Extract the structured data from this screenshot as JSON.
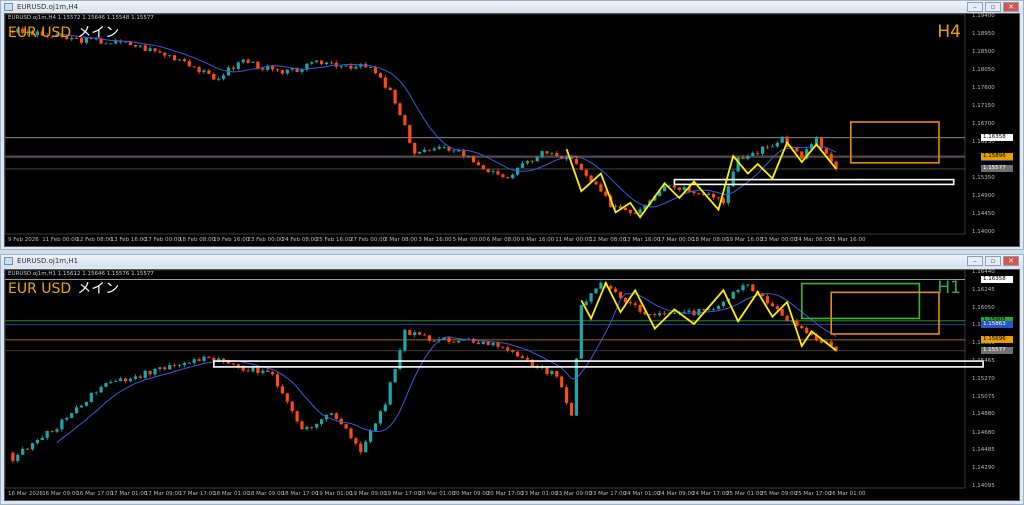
{
  "windows": [
    {
      "title": "EURUSD.oj1m,H4",
      "header": "EURUSD.oj1m,H4  1.15572 1.15646 1.15548 1.15577",
      "symbol": "EUR USD",
      "label": "メイン",
      "timeframe": "H4",
      "tf_color": "#f0a000",
      "price_labels": [
        "1.19400",
        "1.18950",
        "1.18500",
        "1.18050",
        "1.17600",
        "1.17150",
        "1.16700",
        "1.16250",
        "1.15350",
        "1.14900",
        "1.14450",
        "1.14000"
      ],
      "price_tags": [
        {
          "value": "1.16358",
          "bg": "#ffffff",
          "fg": "#000"
        },
        {
          "value": "1.15863",
          "bg": "#2a52c8",
          "fg": "#fff"
        },
        {
          "value": "1.15896",
          "bg": "#e8a000",
          "fg": "#000"
        },
        {
          "value": "1.15577",
          "bg": "#707070",
          "fg": "#fff"
        }
      ],
      "time_labels": [
        "9 Feb 2026",
        "11 Feb 00:00",
        "12 Feb 08:00",
        "13 Feb 16:00",
        "17 Feb 00:00",
        "18 Feb 08:00",
        "19 Feb 16:00",
        "23 Feb 00:00",
        "24 Feb 08:00",
        "25 Feb 16:00",
        "27 Feb 00:00",
        "2 Mar 08:00",
        "3 Mar 16:00",
        "5 Mar 00:00",
        "6 Mar 08:00",
        "9 Mar 16:00",
        "11 Mar 00:00",
        "12 Mar 08:00",
        "13 Mar 16:00",
        "17 Mar 00:00",
        "18 Mar 08:00",
        "19 Mar 16:00",
        "23 Mar 00:00",
        "24 Mar 08:00",
        "25 Mar 16:00"
      ],
      "window_buttons": [
        "minimize",
        "restore",
        "close"
      ]
    },
    {
      "title": "EURUSD.oj1m,H1",
      "header": "EURUSD.oj1m,H1  1.15612 1.15646 1.15576 1.15577",
      "symbol": "EUR USD",
      "label": "メイン",
      "timeframe": "H1",
      "tf_color": "#2eaa66",
      "price_labels": [
        "1.16440",
        "1.16245",
        "1.16050",
        "1.15855",
        "1.15660",
        "1.15465",
        "1.15270",
        "1.15075",
        "1.14880",
        "1.14680",
        "1.14485",
        "1.14290",
        "1.14095"
      ],
      "price_tags": [
        {
          "value": "1.16358",
          "bg": "#ffffff",
          "fg": "#000"
        },
        {
          "value": "1.15905",
          "bg": "#22aa33",
          "fg": "#000"
        },
        {
          "value": "1.15863",
          "bg": "#2a52c8",
          "fg": "#fff"
        },
        {
          "value": "1.15696",
          "bg": "#e8a000",
          "fg": "#000"
        },
        {
          "value": "1.15577",
          "bg": "#707070",
          "fg": "#fff"
        }
      ],
      "time_labels": [
        "16 Mar 2026",
        "16 Mar 09:00",
        "16 Mar 17:00",
        "17 Mar 01:00",
        "17 Mar 09:00",
        "17 Mar 17:00",
        "18 Mar 01:00",
        "18 Mar 09:00",
        "18 Mar 17:00",
        "19 Mar 01:00",
        "19 Mar 09:00",
        "19 Mar 17:00",
        "20 Mar 01:00",
        "20 Mar 09:00",
        "20 Mar 17:00",
        "23 Mar 01:00",
        "23 Mar 09:00",
        "23 Mar 17:00",
        "24 Mar 01:00",
        "24 Mar 09:00",
        "24 Mar 17:00",
        "25 Mar 01:00",
        "25 Mar 09:00",
        "25 Mar 17:00",
        "26 Mar 01:00"
      ],
      "window_buttons": [
        "minimize",
        "restore",
        "close"
      ]
    }
  ],
  "chart_data": [
    {
      "type": "candlestick",
      "title": "EURUSD H4",
      "ylim": [
        1.14,
        1.194
      ],
      "bull_color": "#1aa8a8",
      "bear_color": "#ff4a10",
      "ma_color": "#3a5ae0",
      "anchors": [
        [
          0,
          1.1905
        ],
        [
          11,
          1.1885
        ],
        [
          25,
          1.187
        ],
        [
          36,
          1.183
        ],
        [
          42,
          1.178
        ],
        [
          48,
          1.183
        ],
        [
          56,
          1.1795
        ],
        [
          64,
          1.1825
        ],
        [
          74,
          1.181
        ],
        [
          78,
          1.175
        ],
        [
          83,
          1.16
        ],
        [
          91,
          1.161
        ],
        [
          101,
          1.153
        ],
        [
          109,
          1.16
        ],
        [
          115,
          1.158
        ],
        [
          123,
          1.147
        ],
        [
          128,
          1.145
        ],
        [
          134,
          1.152
        ],
        [
          142,
          1.15
        ],
        [
          146,
          1.148
        ],
        [
          149,
          1.158
        ],
        [
          158,
          1.163
        ],
        [
          162,
          1.159
        ],
        [
          165,
          1.163
        ],
        [
          169,
          1.1558
        ]
      ],
      "hlines": [
        {
          "price": 1.16358,
          "color": "#9a9a9a"
        },
        {
          "price": 1.15863,
          "color": "#2a52c8"
        },
        {
          "price": 1.15896,
          "color": "#e08a00"
        },
        {
          "price": 1.15577,
          "color": "#505050"
        }
      ],
      "zigzag": [
        [
          114,
          1.1607
        ],
        [
          117,
          1.1502
        ],
        [
          121,
          1.1546
        ],
        [
          124,
          1.1449
        ],
        [
          127,
          1.1473
        ],
        [
          129,
          1.1437
        ],
        [
          134,
          1.1522
        ],
        [
          137,
          1.1485
        ],
        [
          140,
          1.1526
        ],
        [
          145,
          1.1456
        ],
        [
          148,
          1.159
        ],
        [
          151,
          1.1546
        ],
        [
          153,
          1.157
        ],
        [
          156,
          1.1534
        ],
        [
          159,
          1.1624
        ],
        [
          162,
          1.1575
        ],
        [
          165,
          1.1619
        ],
        [
          169,
          1.1558
        ]
      ],
      "projection": [
        [
          169,
          1.1539
        ],
        [
          172,
          1.1563
        ],
        [
          175,
          1.1558
        ],
        [
          178,
          1.1502
        ]
      ],
      "zones": [
        {
          "from": 136,
          "to": 193,
          "top": 1.1531,
          "bottom": 1.1519,
          "color": "#ffffff"
        },
        {
          "from": 172,
          "to": 190,
          "top": 1.1675,
          "bottom": 1.1573,
          "color": "#e88a10"
        }
      ]
    },
    {
      "type": "candlestick",
      "title": "EURUSD H1",
      "ylim": [
        1.14095,
        1.1644
      ],
      "bull_color": "#1aa8a8",
      "bear_color": "#ff4a10",
      "ma_color": "#3a5ae0",
      "anchors": [
        [
          0,
          1.1445
        ],
        [
          1,
          1.144
        ],
        [
          9,
          1.147
        ],
        [
          19,
          1.152
        ],
        [
          40,
          1.155
        ],
        [
          54,
          1.153
        ],
        [
          60,
          1.147
        ],
        [
          66,
          1.149
        ],
        [
          72,
          1.145
        ],
        [
          77,
          1.15
        ],
        [
          81,
          1.158
        ],
        [
          87,
          1.157
        ],
        [
          95,
          1.157
        ],
        [
          101,
          1.156
        ],
        [
          112,
          1.153
        ],
        [
          115,
          1.149
        ],
        [
          117,
          1.161
        ],
        [
          121,
          1.163
        ],
        [
          130,
          1.16
        ],
        [
          142,
          1.16
        ],
        [
          151,
          1.163
        ],
        [
          162,
          1.158
        ],
        [
          169,
          1.1558
        ]
      ],
      "hlines": [
        {
          "price": 1.16358,
          "color": "#cccccc"
        },
        {
          "price": 1.15905,
          "color": "#22aa33"
        },
        {
          "price": 1.15863,
          "color": "#2a52c8"
        },
        {
          "price": 1.15696,
          "color": "#e08a00"
        },
        {
          "price": 1.15577,
          "color": "#505050"
        }
      ],
      "zigzag": [
        [
          117,
          1.1613
        ],
        [
          119,
          1.1593
        ],
        [
          122,
          1.1632
        ],
        [
          125,
          1.16
        ],
        [
          128,
          1.1624
        ],
        [
          132,
          1.1582
        ],
        [
          136,
          1.1603
        ],
        [
          140,
          1.1587
        ],
        [
          146,
          1.1624
        ],
        [
          149,
          1.159
        ],
        [
          153,
          1.1622
        ],
        [
          156,
          1.1595
        ],
        [
          159,
          1.1611
        ],
        [
          162,
          1.1563
        ],
        [
          164,
          1.1579
        ],
        [
          169,
          1.1558
        ]
      ],
      "projection": [],
      "zones": [
        {
          "from": 42,
          "to": 199,
          "top": 1.15464,
          "bottom": 1.154,
          "color": "#ffffff"
        },
        {
          "from": 162,
          "to": 186,
          "top": 1.16313,
          "bottom": 1.15931,
          "color": "#33bb33"
        },
        {
          "from": 168,
          "to": 190,
          "top": 1.16217,
          "bottom": 1.15761,
          "color": "#e88a10"
        }
      ]
    }
  ]
}
